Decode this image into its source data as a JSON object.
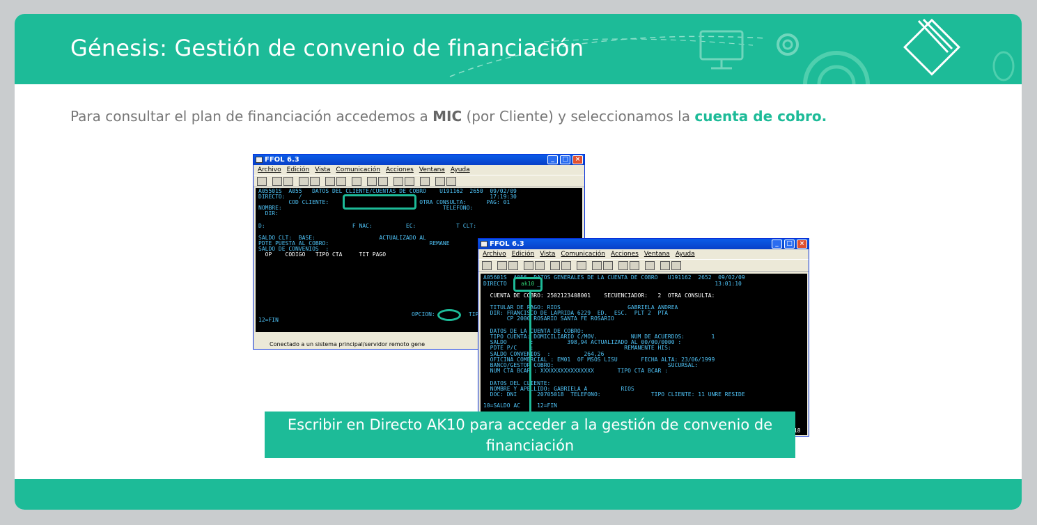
{
  "slide": {
    "title": "Génesis: Gestión de convenio de financiación",
    "intro": {
      "part1": "Para consultar el plan de financiación accedemos a ",
      "bold": "MIC",
      "part2": " (por Cliente) y seleccionamos la ",
      "highlight": "cuenta de cobro."
    },
    "caption": "Escribir en Directo AK10 para acceder a la gestión de convenio de financiación"
  },
  "colors": {
    "accent": "#1dbb98",
    "terminal_bg": "#000000",
    "terminal_text": "#4fc3f7"
  },
  "window1": {
    "title": "FFOL 6.3",
    "menu": [
      "Archivo",
      "Edición",
      "Vista",
      "Comunicación",
      "Acciones",
      "Ventana",
      "Ayuda"
    ],
    "lines": [
      "A05501S  A055   DATOS DEL CLIENTE/CUENTAS DE COBRO    U191162  2650  09/02/09",
      "DIRECTO:    /                                                        17:19:30",
      "         COD CLIENTE:                           OTRA CONSULTA:      PAG: 01",
      "NOMBRE:                                                TELEFONO:",
      "  DIR:",
      "",
      "D:                          F NAC:          EC:            T CLT:",
      "",
      "SALDO CLT:  BASE:                   ACTUALIZADO AL",
      "PDTE PUESTA AL COBRO:                              REMANE",
      "SALDO DE CONVENIOS  :",
      "  OP    CODIGO   TIPO CTA     TIT PAGO"
    ],
    "opcion": "OPCION:          TIP",
    "fn": "12=FIN",
    "status": "Conectado a un sistema principal/servidor remoto gene"
  },
  "window2": {
    "title": "FFOL 6.3",
    "menu": [
      "Archivo",
      "Edición",
      "Vista",
      "Comunicación",
      "Acciones",
      "Ventana",
      "Ayuda"
    ],
    "lines": [
      "A05601S  A056  DATOS GENERALES DE LA CUENTA DE COBRO   U191162  2652  09/02/09",
      "DIRECTO         _                                                    13:01:10",
      "",
      "  CUENTA DE COBRO: 2502123408001    SECUENCIADOR:   2  OTRA CONSULTA:",
      "",
      "  TITULAR DE PAGO: RIOS                    GABRIELA ANDREA",
      "  DIR: FRANCISCO DE LAPRIDA 6229  ED.  ESC.  PLT 2  PTA",
      "       CP 2000 ROSARIO SANTA FE ROSARIO",
      "",
      "  DATOS DE LA CUENTA DE COBRO:",
      "  TIPO CUENTA: DOMICILIARIO C/MOV.          NUM DE ACUERDOS:        1",
      "  SALDO       :          398,94 ACTUALIZADO AL 00/00/0000 :",
      "  PDTE P/C    :                           REMANENTE HIS:",
      "  SALDO CONVENIOS  :          264,26",
      "  OFICINA COMERCIAL : EM01  OF MSOS LISU       FECHA ALTA: 23/06/1999",
      "  BANCO/GESTOR COBRO:                                  SUCURSAL:",
      "  NUM CTA BCAR : XXXXXXXXXXXXXXXX       TIPO CTA BCAR :",
      "",
      "  DATOS DEL CLIENTE:",
      "  NOMBRE Y APELLIDO: GABRIELA A          RIOS",
      "  DOC: DNI      20705018  TELEFONO:               TIPO CLIENTE: 11 UNRE RESIDE",
      "",
      "10=SALDO AC     12=FIN"
    ],
    "directo_value": "ak10",
    "cuenta_value": "2502123408001",
    "page_tail": "018"
  }
}
